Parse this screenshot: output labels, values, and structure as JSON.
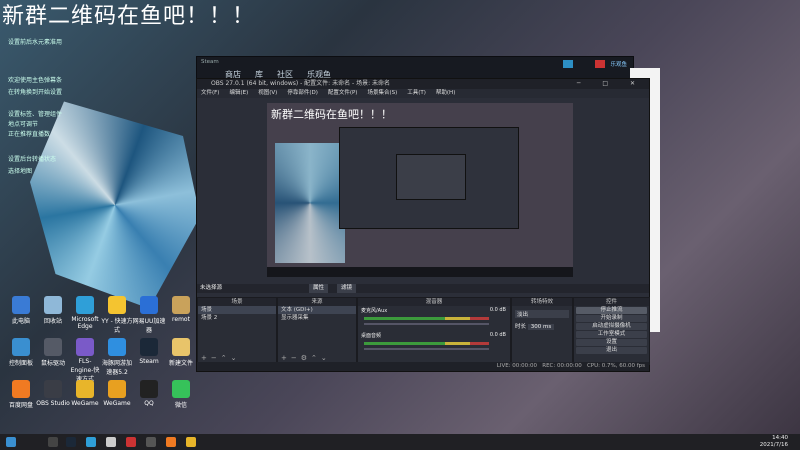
{
  "desktop": {
    "big_title": "新群二维码在鱼吧！！！",
    "notes": [
      "设置前后水元素准用",
      "欢迎使用主色弹幕条",
      "在转角换到开始设置",
      "设置标签、管理组件",
      "地点可调节",
      "正在推荐直播数",
      "设置后台转播状态",
      "选择地图"
    ]
  },
  "desktop_icons": [
    {
      "label": "此电脑",
      "color": "#3a7bd5"
    },
    {
      "label": "回收站",
      "color": "#8fb8d8"
    },
    {
      "label": "Microsoft Edge",
      "color": "#2f9fd8"
    },
    {
      "label": "YY - 快速方式",
      "color": "#f4c430"
    },
    {
      "label": "网易UU加速器",
      "color": "#2b6fd6"
    },
    {
      "label": "remot",
      "color": "#c9a25b"
    },
    {
      "label": "控制面板",
      "color": "#3a8fd0"
    },
    {
      "label": "鼠标驱动",
      "color": "#555a66"
    },
    {
      "label": "FLS-Engine-快速方式",
      "color": "#7a5ac8"
    },
    {
      "label": "海豚网游加速器5.2",
      "color": "#2f8fe0"
    },
    {
      "label": "Steam",
      "color": "#1b2838"
    },
    {
      "label": "新建文件",
      "color": "#e8c46a"
    },
    {
      "label": "百度网盘",
      "color": "#f07a22"
    },
    {
      "label": "OBS Studio",
      "color": "#3a3d46"
    },
    {
      "label": "WeGame",
      "color": "#e8b52a"
    },
    {
      "label": "WeGame",
      "color": "#e8a020"
    },
    {
      "label": "QQ",
      "color": "#222"
    },
    {
      "label": "微信",
      "color": "#36c25a"
    }
  ],
  "steam": {
    "title": "Steam",
    "nav": [
      "商店",
      "库",
      "社区",
      "乐观鱼"
    ],
    "user_label": "乐观鱼"
  },
  "obs": {
    "title": "OBS 27.0.1 (64 bit, windows) - 配置文件: 未命名 - 场景: 未命名",
    "menu": [
      "文件(F)",
      "编辑(E)",
      "视图(V)",
      "停靠部件(D)",
      "配置文件(P)",
      "场景集合(S)",
      "工具(T)",
      "帮助(H)"
    ],
    "preview_title": "新群二维码在鱼吧！！！",
    "no_source_label": "未选择源",
    "properties_label": "属性",
    "filters_label": "滤镜",
    "docks": {
      "scenes": {
        "header": "场景",
        "items": [
          "场景",
          "场景 2"
        ]
      },
      "sources": {
        "header": "来源",
        "items": [
          "文本 (GDI+)",
          "显示器采集"
        ]
      },
      "mixer": {
        "header": "混音器",
        "channels": [
          {
            "name": "麦克风/Aux",
            "db": "0.0 dB"
          },
          {
            "name": "桌面音频",
            "db": "0.0 dB"
          }
        ]
      },
      "transitions": {
        "header": "转场特效",
        "type": "淡出",
        "duration_label": "时长",
        "duration": "300 ms"
      },
      "controls": {
        "header": "控件",
        "buttons": [
          "停止推流",
          "开始录制",
          "启动虚拟摄像机",
          "工作室模式",
          "设置",
          "退出"
        ]
      }
    },
    "status": {
      "live": "LIVE: 00:00:00",
      "rec": "REC: 00:00:00",
      "cpu": "CPU: 0.7%, 60.00 fps"
    }
  },
  "taskbar": {
    "time": "14:40",
    "date": "2021/7/16"
  }
}
